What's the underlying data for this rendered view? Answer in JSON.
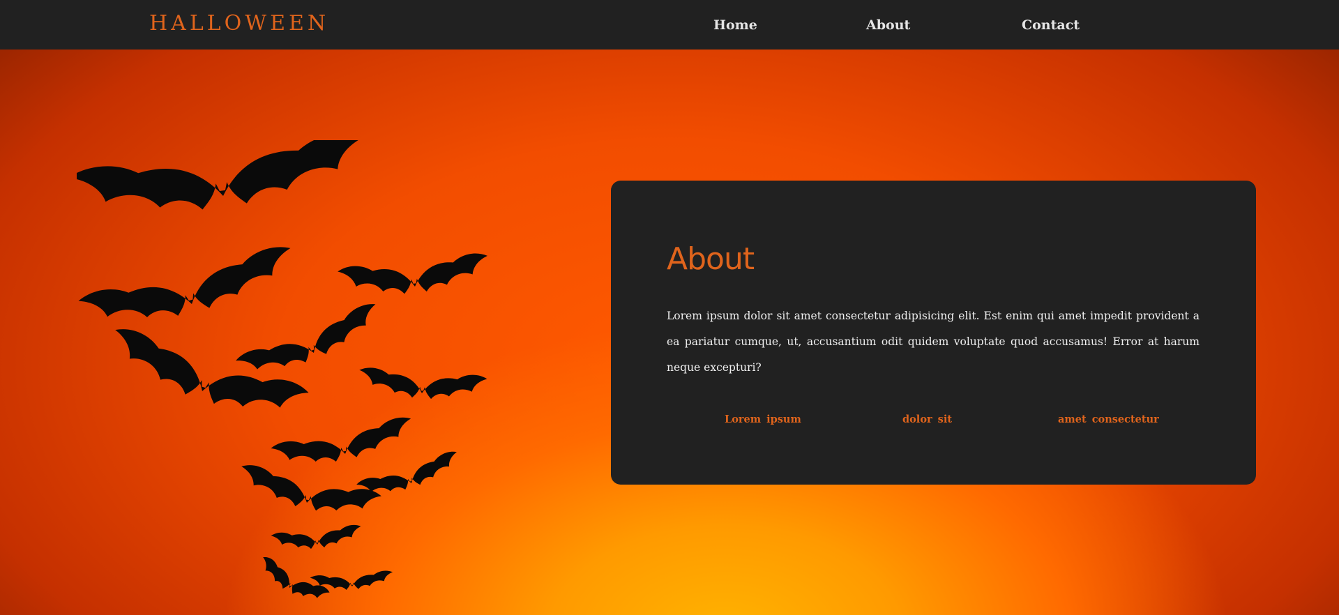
{
  "brand": {
    "name": "HALLOWEEN",
    "color": "#e0641c"
  },
  "nav": {
    "items": [
      {
        "label": "Home"
      },
      {
        "label": "About"
      },
      {
        "label": "Contact"
      }
    ]
  },
  "hero": {
    "illustration": "bat-swarm-icon",
    "colors": {
      "glow": "#ffb300",
      "mid": "#ff5a00",
      "edge": "#7a1d00"
    }
  },
  "about_card": {
    "title": "About",
    "text": "Lorem ipsum dolor sit amet consectetur adipisicing elit. Est enim qui amet impedit provident a ea pariatur cumque, ut, accusantium odit quidem voluptate quod accusamus! Error at harum neque excepturi?",
    "links": [
      {
        "label": "Lorem ipsum"
      },
      {
        "label": "dolor sit"
      },
      {
        "label": "amet consectetur"
      }
    ],
    "background": "#212121",
    "accent": "#e0641c"
  }
}
